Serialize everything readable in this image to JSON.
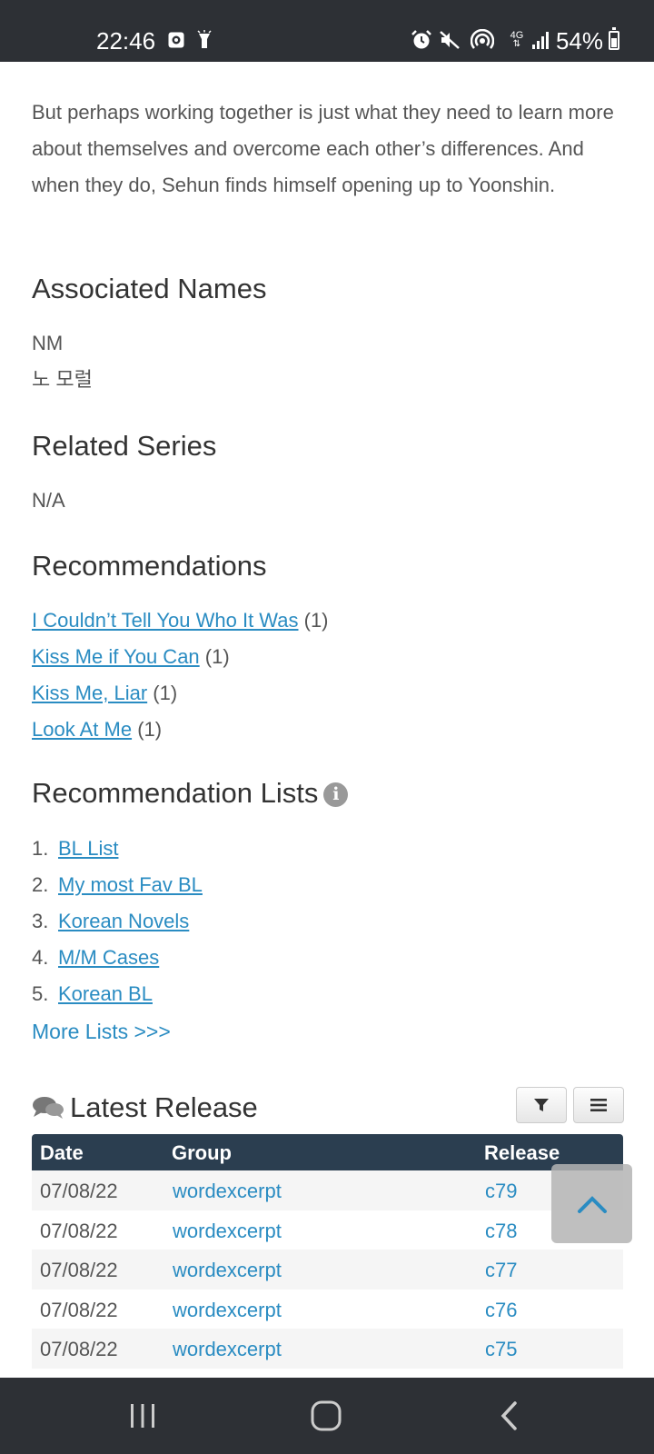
{
  "status_bar": {
    "time": "22:46",
    "battery": "54%",
    "network": "4G",
    "left_icons": [
      "screen-record-icon",
      "flashlight-icon"
    ],
    "right_icons": [
      "alarm-icon",
      "mute-icon",
      "hotspot-icon",
      "4g-icon",
      "signal-icon",
      "battery-icon"
    ]
  },
  "description": "But perhaps working together is just what they need to learn more about themselves and overcome each other’s differences. And when they do, Sehun finds himself opening up to Yoonshin.",
  "associated_names": {
    "heading": "Associated Names",
    "names": [
      "NM",
      "노 모럴"
    ]
  },
  "related_series": {
    "heading": "Related Series",
    "value": "N/A"
  },
  "recommendations": {
    "heading": "Recommendations",
    "items": [
      {
        "title": "I Couldn’t Tell You Who It Was",
        "count": "(1)"
      },
      {
        "title": "Kiss Me if You Can",
        "count": "(1)"
      },
      {
        "title": "Kiss Me, Liar",
        "count": "(1)"
      },
      {
        "title": "Look At Me",
        "count": "(1)"
      }
    ]
  },
  "recommendation_lists": {
    "heading": "Recommendation Lists",
    "info_icon_glyph": "i",
    "items": [
      {
        "num": "1.",
        "title": "BL List"
      },
      {
        "num": "2.",
        "title": "My most Fav BL"
      },
      {
        "num": "3.",
        "title": "Korean Novels"
      },
      {
        "num": "4.",
        "title": "M/M Cases"
      },
      {
        "num": "5.",
        "title": "Korean BL"
      }
    ],
    "more": "More Lists >>>"
  },
  "latest_release": {
    "heading": "Latest Release",
    "columns": [
      "Date",
      "Group",
      "Release"
    ],
    "rows": [
      {
        "date": "07/08/22",
        "group": "wordexcerpt",
        "release": "c79"
      },
      {
        "date": "07/08/22",
        "group": "wordexcerpt",
        "release": "c78"
      },
      {
        "date": "07/08/22",
        "group": "wordexcerpt",
        "release": "c77"
      },
      {
        "date": "07/08/22",
        "group": "wordexcerpt",
        "release": "c76"
      },
      {
        "date": "07/08/22",
        "group": "wordexcerpt",
        "release": "c75"
      }
    ]
  },
  "colors": {
    "link": "#2a8cc2",
    "table_header": "#2b3e50",
    "system_bar": "#2d3035"
  }
}
